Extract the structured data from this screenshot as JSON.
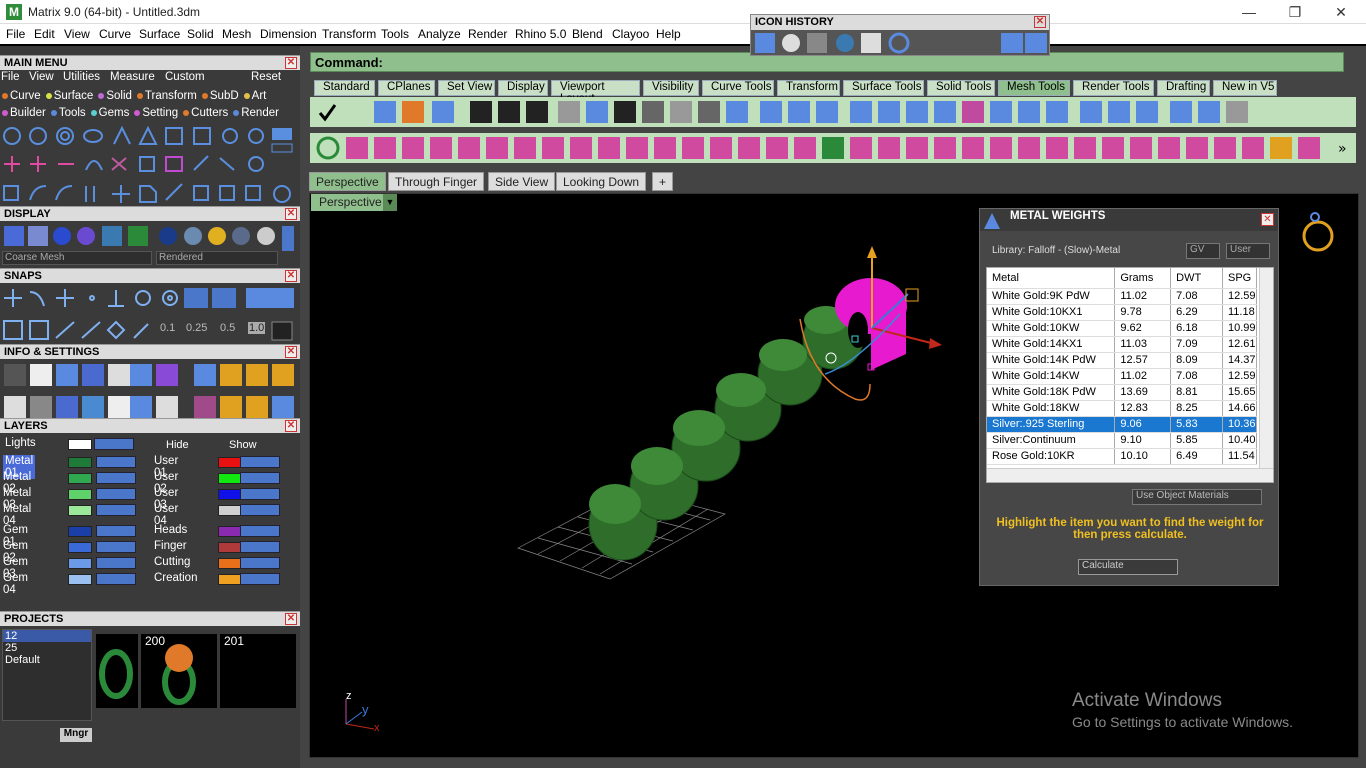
{
  "window": {
    "title": "Matrix 9.0 (64-bit) - Untitled.3dm",
    "min": "—",
    "max": "❐",
    "close": "✕"
  },
  "menubar": [
    "File",
    "Edit",
    "View",
    "Curve",
    "Surface",
    "Solid",
    "Mesh",
    "Dimension",
    "Transform",
    "Tools",
    "Analyze",
    "Render",
    "Rhino 5.0",
    "Blend",
    "Clayoo",
    "Help"
  ],
  "main_menu": {
    "header": "MAIN MENU",
    "row1": [
      "File",
      "View",
      "Utilities",
      "Measure",
      "Custom"
    ],
    "reset": "Reset",
    "row2": [
      {
        "t": "Curve",
        "c": "#e07a2a"
      },
      {
        "t": "Surface",
        "c": "#d8e04a"
      },
      {
        "t": "Solid",
        "c": "#c06ad8"
      },
      {
        "t": "Transform",
        "c": "#e07a2a"
      },
      {
        "t": "SubD",
        "c": "#e07a2a"
      },
      {
        "t": "Art",
        "c": "#e0c04a"
      }
    ],
    "row3": [
      {
        "t": "Builder",
        "c": "#d05ad0"
      },
      {
        "t": "Tools",
        "c": "#5a8ad8"
      },
      {
        "t": "Gems",
        "c": "#5ad0d0"
      },
      {
        "t": "Setting",
        "c": "#d05ad0"
      },
      {
        "t": "Cutters",
        "c": "#e07a2a"
      },
      {
        "t": "Render",
        "c": "#5a8ad8"
      }
    ]
  },
  "display": {
    "header": "DISPLAY",
    "mesh_select": "Coarse Mesh",
    "render_select": "Rendered"
  },
  "snaps": {
    "header": "SNAPS",
    "values": [
      "0.1",
      "0.25",
      "0.5",
      "1.0"
    ]
  },
  "info": {
    "header": "INFO & SETTINGS"
  },
  "layers": {
    "header": "LAYERS",
    "lights": "Lights",
    "hide": "Hide",
    "show": "Show",
    "left": [
      {
        "name": "Metal 01",
        "color": "#1f7a3a",
        "sel": true
      },
      {
        "name": "Metal 02",
        "color": "#2fa84f"
      },
      {
        "name": "Metal 03",
        "color": "#5fd06a"
      },
      {
        "name": "Metal 04",
        "color": "#9be89a"
      },
      {
        "name": "Gem 01",
        "color": "#1a3fa8"
      },
      {
        "name": "Gem 02",
        "color": "#3a6ad8"
      },
      {
        "name": "Gem 03",
        "color": "#6a9ae8"
      },
      {
        "name": "Gem 04",
        "color": "#9ac0f0"
      }
    ],
    "right": [
      {
        "name": "User 01",
        "color": "#e81010"
      },
      {
        "name": "User 02",
        "color": "#10e810"
      },
      {
        "name": "User 03",
        "color": "#1010e8"
      },
      {
        "name": "User 04",
        "color": "#d0d0d0"
      },
      {
        "name": "Heads",
        "color": "#8a2ab0"
      },
      {
        "name": "Finger",
        "color": "#b03a3a"
      },
      {
        "name": "Cutting",
        "color": "#e8701a"
      },
      {
        "name": "Creation",
        "color": "#f0a020"
      }
    ]
  },
  "projects": {
    "header": "PROJECTS",
    "list": [
      "12",
      "25",
      "Default"
    ],
    "thumbs": [
      "200",
      "201"
    ],
    "mngr": "Mngr"
  },
  "command": {
    "label": "Command:"
  },
  "toolbar_tabs": [
    "Standard",
    "CPlanes",
    "Set View",
    "Display",
    "Viewport Layout",
    "Visibility",
    "Curve Tools",
    "Transform",
    "Surface Tools",
    "Solid Tools",
    "Mesh Tools",
    "Render Tools",
    "Drafting",
    "New in V5"
  ],
  "icon_history": {
    "title": "ICON HISTORY"
  },
  "view_tabs": [
    "Perspective",
    "Through Finger",
    "Side View",
    "Looking Down",
    "+"
  ],
  "viewport": {
    "label": "Perspective",
    "axis_z": "z",
    "axis_y": "y",
    "axis_x": "x"
  },
  "metal_weights": {
    "title": "METAL WEIGHTS",
    "library": "Library: Falloff - (Slow)-Metal",
    "gv": "GV",
    "user": "User",
    "headers": [
      "Metal",
      "Grams",
      "DWT",
      "SPG"
    ],
    "rows": [
      [
        "White Gold:9K PdW",
        "11.02",
        "7.08",
        "12.59"
      ],
      [
        "White Gold:10KX1",
        "9.78",
        "6.29",
        "11.18"
      ],
      [
        "White Gold:10KW",
        "9.62",
        "6.18",
        "10.99"
      ],
      [
        "White Gold:14KX1",
        "11.03",
        "7.09",
        "12.61"
      ],
      [
        "White Gold:14K PdW",
        "12.57",
        "8.09",
        "14.37"
      ],
      [
        "White Gold:14KW",
        "11.02",
        "7.08",
        "12.59"
      ],
      [
        "White Gold:18K PdW",
        "13.69",
        "8.81",
        "15.65"
      ],
      [
        "White Gold:18KW",
        "12.83",
        "8.25",
        "14.66"
      ],
      [
        "Silver:.925 Sterling",
        "9.06",
        "5.83",
        "10.36"
      ],
      [
        "Silver:Continuum",
        "9.10",
        "5.85",
        "10.40"
      ],
      [
        "Rose Gold:10KR",
        "10.10",
        "6.49",
        "11.54"
      ]
    ],
    "selected_row": 8,
    "use_object": "Use Object Materials",
    "hint": "Highlight the item you want to find the weight for then press calculate.",
    "calculate": "Calculate"
  },
  "watermark": {
    "line1": "Activate Windows",
    "line2": "Go to Settings to activate Windows."
  }
}
